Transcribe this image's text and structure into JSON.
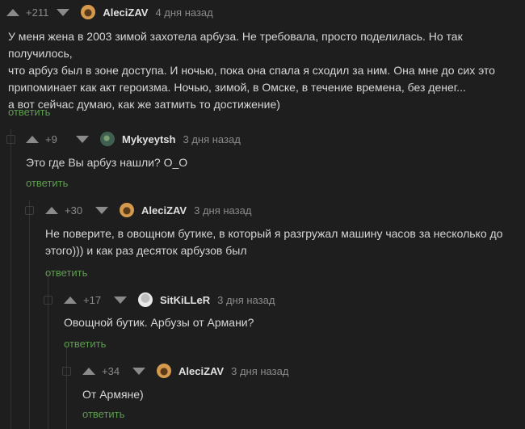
{
  "comments": [
    {
      "rating": "+211",
      "user": "AleciZAV",
      "time": "4 дня назад",
      "text_lines": [
        "У меня жена в 2003 зимой захотела арбуза. Не требовала, просто поделилась. Но так получилось,",
        "что арбуз был в зоне доступа. И ночью, пока она спала я сходил за ним. Она мне до сих это",
        "припоминает как акт героизма. Ночью, зимой, в Омске, в течение времена, без денег...",
        "а вот сейчас думаю, как же затмить то достижение)"
      ],
      "reply": "ответить"
    },
    {
      "rating": "+9",
      "user": "Mykyeytsh",
      "time": "3 дня назад",
      "text_lines": [
        "Это где Вы арбуз нашли? О_О"
      ],
      "reply": "ответить"
    },
    {
      "rating": "+30",
      "user": "AleciZAV",
      "time": "3 дня назад",
      "text_lines": [
        "Не поверите, в овощном бутике, в который я разгружал машину часов за несколько до",
        "этого))) и как раз десяток арбузов был"
      ],
      "reply": "ответить"
    },
    {
      "rating": "+17",
      "user": "SitKiLLeR",
      "time": "3 дня назад",
      "text_lines": [
        "Овощной бутик. Арбузы от Армани?"
      ],
      "reply": "ответить"
    },
    {
      "rating": "+34",
      "user": "AleciZAV",
      "time": "3 дня назад",
      "text_lines": [
        "От Армяне)"
      ],
      "reply": "ответить"
    }
  ]
}
